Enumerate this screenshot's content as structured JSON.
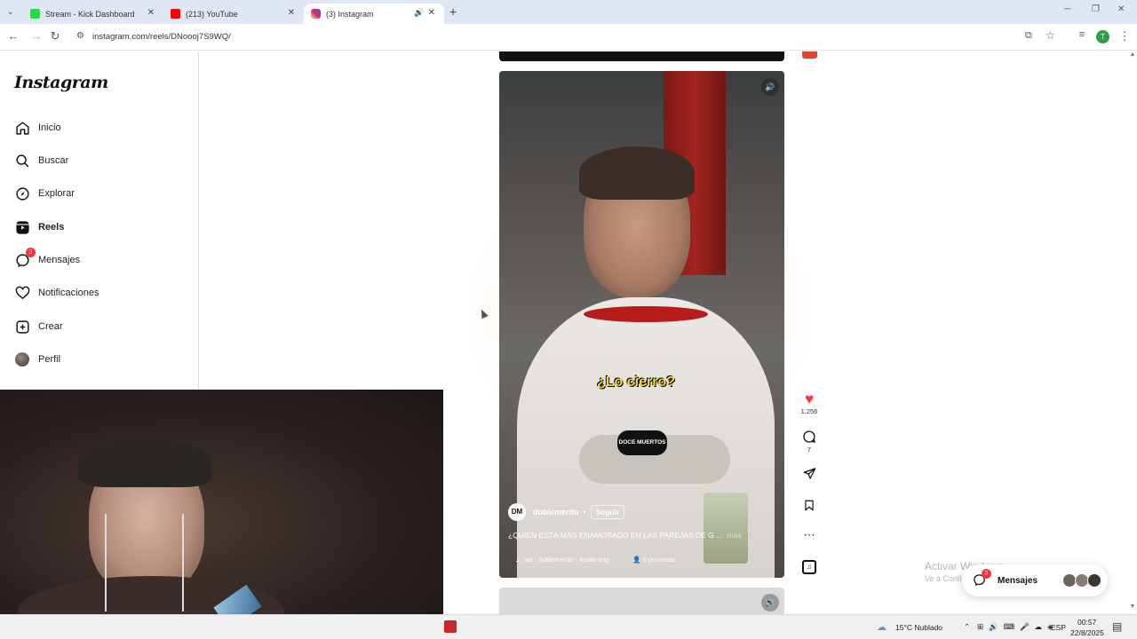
{
  "browser": {
    "tabs": [
      {
        "title": "Stream - Kick Dashboard",
        "favicon_color": "#2bd64b"
      },
      {
        "title": "(213) YouTube",
        "favicon_color": "#ff0000"
      },
      {
        "title": "(3) Instagram",
        "favicon_color": "#d62976"
      }
    ],
    "url": "instagram.com/reels/DNoooj7S9WQ/",
    "profile_initial": "T"
  },
  "sidebar": {
    "logo": "Instagram",
    "items": [
      {
        "label": "Inicio",
        "icon": "home-icon"
      },
      {
        "label": "Buscar",
        "icon": "search-icon"
      },
      {
        "label": "Explorar",
        "icon": "compass-icon"
      },
      {
        "label": "Reels",
        "icon": "reels-icon",
        "active": true
      },
      {
        "label": "Mensajes",
        "icon": "messenger-icon",
        "badge": "3"
      },
      {
        "label": "Notificaciones",
        "icon": "heart-icon"
      },
      {
        "label": "Crear",
        "icon": "plus-square-icon"
      },
      {
        "label": "Perfil",
        "icon": "avatar"
      }
    ]
  },
  "reel": {
    "overlay_text": "¿Lo cierro?",
    "logo_text": "DOCE MUERTOS",
    "username": "doblemerito",
    "follow": "Seguir",
    "caption": "¿QUIÉN ESTÁ MÁS ENAMORADO EN LAS PAREJAS DE G ...",
    "more": "más",
    "audio": "nal · doblemerito · Audio orig",
    "people": "6 personas",
    "likes": "1.256",
    "comments": "7"
  },
  "messages_pill": {
    "label": "Mensajes",
    "badge": "3"
  },
  "watermark": {
    "title": "Activar Windows",
    "subtitle": "Ve a Configuración para activar Windows."
  },
  "taskbar": {
    "weather": "15°C  Nublado",
    "lang": "ESP",
    "time": "00:57",
    "date": "22/8/2025"
  },
  "colors": {
    "like": "#ff3040",
    "accent": "#0095f6"
  }
}
